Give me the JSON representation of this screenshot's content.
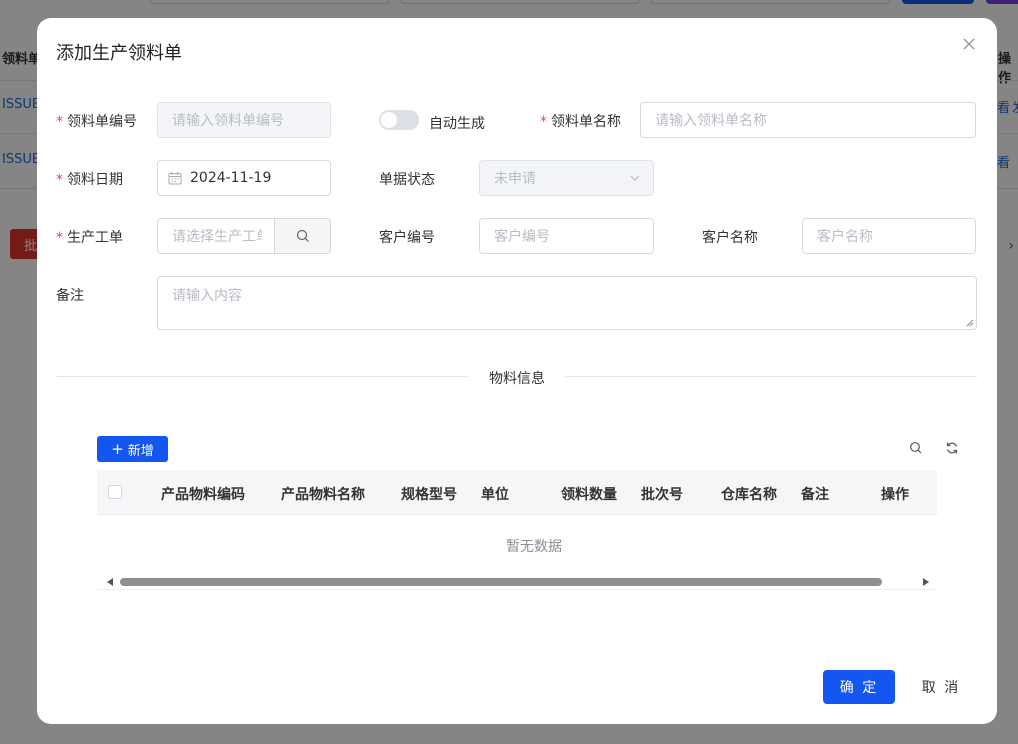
{
  "background": {
    "table_headers": [
      "领料单",
      "操作"
    ],
    "rows": [
      "ISSUE",
      "ISSUE"
    ],
    "row_action_partial": [
      "看",
      "发",
      "看"
    ],
    "red_button_partial": "批"
  },
  "dialog": {
    "title": "添加生产领料单",
    "form": {
      "issue_code": {
        "label": "领料单编号",
        "placeholder": "请输入领料单编号"
      },
      "auto_generate": {
        "label": "自动生成"
      },
      "issue_name": {
        "label": "领料单名称",
        "placeholder": "请输入领料单名称"
      },
      "issue_date": {
        "label": "领料日期",
        "value": "2024-11-19"
      },
      "doc_status": {
        "label": "单据状态",
        "value": "未申请"
      },
      "work_order": {
        "label": "生产工单",
        "placeholder": "请选择生产工单"
      },
      "customer_code": {
        "label": "客户编号",
        "placeholder": "客户编号"
      },
      "customer_name": {
        "label": "客户名称",
        "placeholder": "客户名称"
      },
      "remark": {
        "label": "备注",
        "placeholder": "请输入内容"
      }
    },
    "divider": "物料信息",
    "add_button": "新增",
    "table": {
      "columns": [
        "产品物料编码",
        "产品物料名称",
        "规格型号",
        "单位",
        "领料数量",
        "批次号",
        "仓库名称",
        "备注",
        "操作"
      ],
      "empty_text": "暂无数据"
    },
    "buttons": {
      "ok": "确 定",
      "cancel": "取 消"
    }
  },
  "colors": {
    "primary": "#1456f0",
    "required": "#e5484d",
    "danger_bg": "#e0342d"
  },
  "icons": {
    "close": "close-icon",
    "calendar": "calendar-icon",
    "search": "search-icon",
    "refresh": "refresh-icon",
    "chevron": "chevron-down-icon"
  }
}
